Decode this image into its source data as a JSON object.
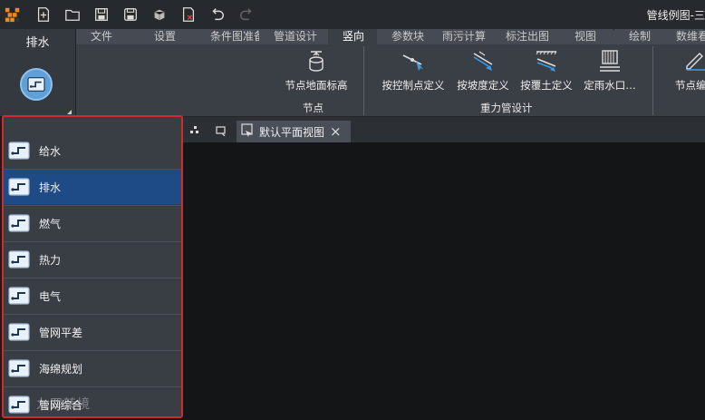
{
  "window": {
    "title": "管线例图-三"
  },
  "module": {
    "label": "排水",
    "icon": "pipe-module-icon"
  },
  "tabs": [
    {
      "label": "文件",
      "active": false
    },
    {
      "label": "设置",
      "active": false
    },
    {
      "label": "条件图准备",
      "active": false
    },
    {
      "label": "管道设计",
      "active": false
    },
    {
      "label": "竖向",
      "active": true
    },
    {
      "label": "参数块",
      "active": false
    },
    {
      "label": "雨污计算",
      "active": false
    },
    {
      "label": "标注出图",
      "active": false
    },
    {
      "label": "视图",
      "active": false
    },
    {
      "label": "绘制",
      "active": false
    },
    {
      "label": "数维看三",
      "active": false
    }
  ],
  "ribbon": {
    "groups": [
      {
        "label": "节点",
        "buttons": [
          {
            "label": "节点地面标高",
            "icon": "node-elevation-icon"
          }
        ]
      },
      {
        "label": "重力管设计",
        "buttons": [
          {
            "label": "按控制点定义",
            "icon": "control-point-icon"
          },
          {
            "label": "按坡度定义",
            "icon": "slope-icon"
          },
          {
            "label": "按覆土定义",
            "icon": "cover-soil-icon"
          },
          {
            "label": "定雨水口…",
            "icon": "rain-inlet-icon"
          }
        ]
      },
      {
        "label": "",
        "buttons": [
          {
            "label": "节点编辑",
            "icon": "node-edit-icon"
          }
        ]
      }
    ]
  },
  "doc_tab": {
    "label": "默认平面视图",
    "close": "×"
  },
  "dropdown": {
    "items": [
      {
        "label": "给水",
        "selected": false
      },
      {
        "label": "排水",
        "selected": true
      },
      {
        "label": "燃气",
        "selected": false
      },
      {
        "label": "热力",
        "selected": false
      },
      {
        "label": "电气",
        "selected": false
      },
      {
        "label": "管网平差",
        "selected": false
      },
      {
        "label": "海绵规划",
        "selected": false
      },
      {
        "label": "管网综合",
        "selected": false
      }
    ],
    "highlight_color": "#d32a2a",
    "selected_color": "#1e4a85"
  },
  "watermark": "九四转境"
}
